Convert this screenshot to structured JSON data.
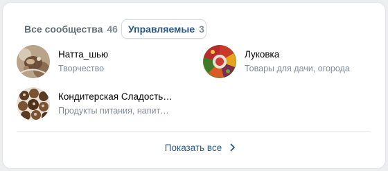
{
  "tabs": {
    "all": {
      "label": "Все сообщества",
      "count": "46"
    },
    "managed": {
      "label": "Управляемые",
      "count": "3"
    }
  },
  "groups": [
    {
      "name": "Натта_шью",
      "category": "Творчество",
      "avatar": "sewing-photo"
    },
    {
      "name": "Луковка",
      "category": "Товары для дачи, огорода",
      "avatar": "vegetables-photo"
    },
    {
      "name": "Кондитерская Сладость…",
      "category": "Продукты питания, напит…",
      "avatar": "candies-photo"
    }
  ],
  "footer": {
    "show_all_label": "Показать все",
    "icon": "chevron-right-icon"
  },
  "colors": {
    "accent": "#2a5885",
    "secondary_text": "#818c99",
    "background": "#edeef0"
  }
}
